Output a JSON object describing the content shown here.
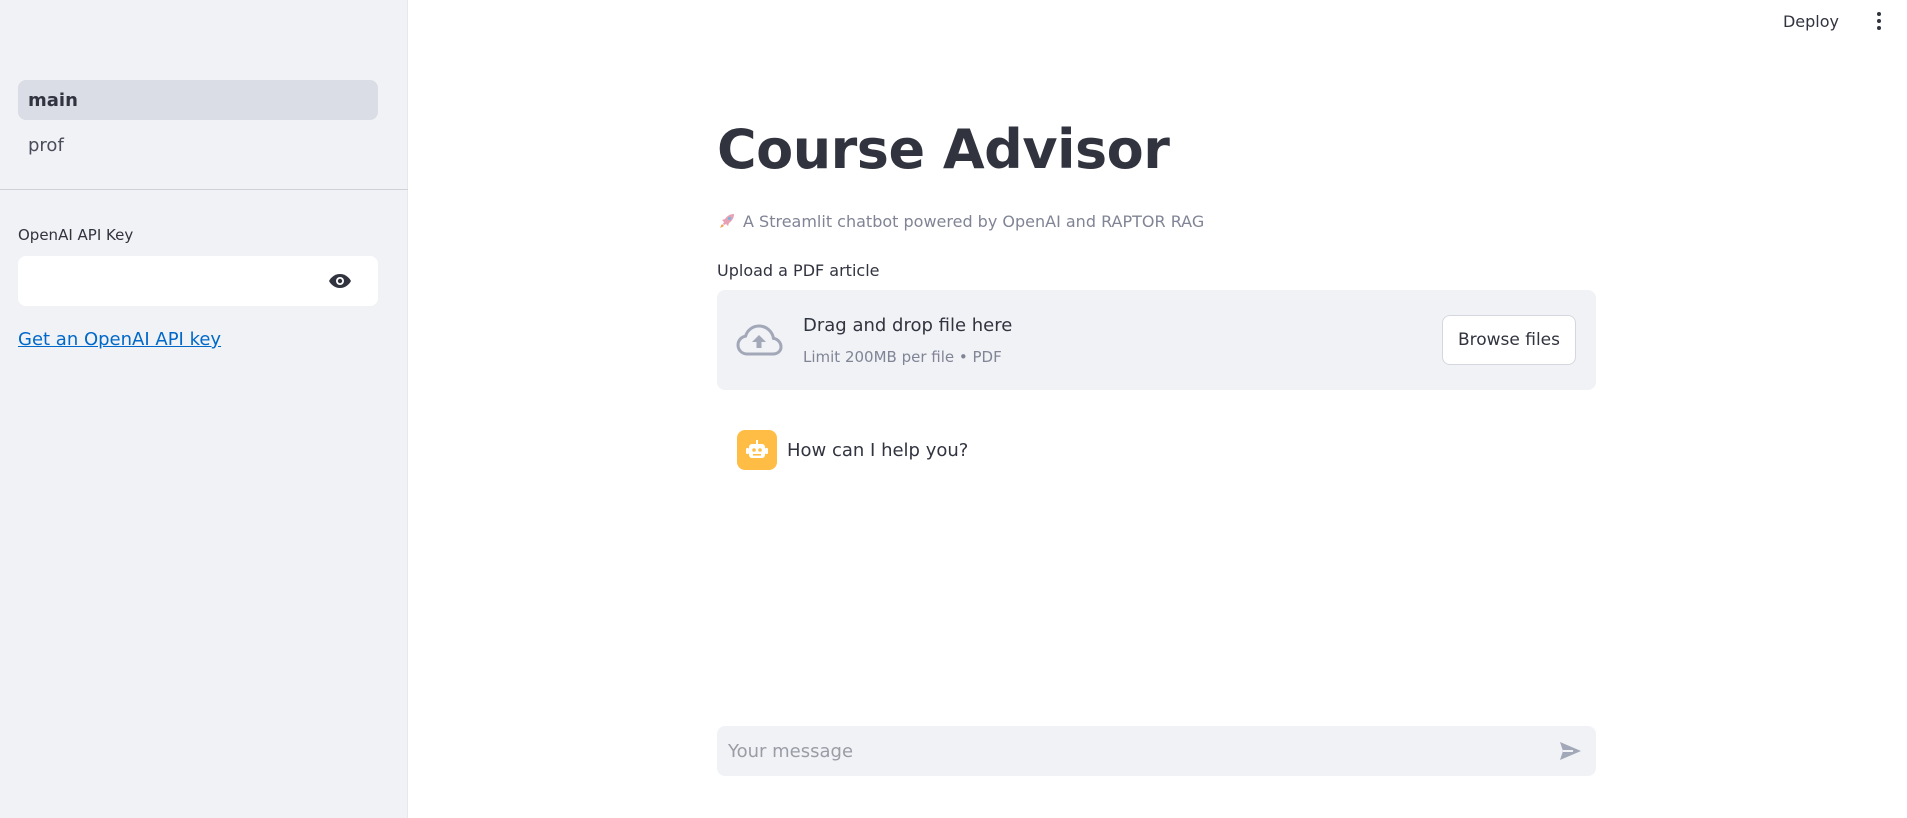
{
  "sidebar": {
    "nav_items": [
      {
        "label": "main",
        "active": true
      },
      {
        "label": "prof",
        "active": false
      }
    ],
    "api_key_label": "OpenAI API Key",
    "api_key_value": "",
    "api_key_link": "Get an OpenAI API key"
  },
  "topbar": {
    "deploy_label": "Deploy",
    "menu_icon": "kebab-menu-icon"
  },
  "main": {
    "title": "Course Advisor",
    "caption": "A Streamlit chatbot powered by OpenAI and RAPTOR RAG",
    "caption_icon": "rocket-icon",
    "upload": {
      "label": "Upload a PDF article",
      "drop_title": "Drag and drop file here",
      "drop_limit": "Limit 200MB per file • PDF",
      "browse_label": "Browse files",
      "icon": "cloud-upload-icon"
    },
    "messages": [
      {
        "role": "assistant",
        "text": "How can I help you?",
        "avatar_icon": "robot-icon"
      }
    ],
    "chat_input": {
      "placeholder": "Your message",
      "value": "",
      "send_icon": "send-icon"
    }
  },
  "colors": {
    "sidebar_bg": "#f0f2f6",
    "link": "#0068c9",
    "avatar_bg": "#ffbd45",
    "text": "#31333f",
    "muted": "#808495"
  }
}
